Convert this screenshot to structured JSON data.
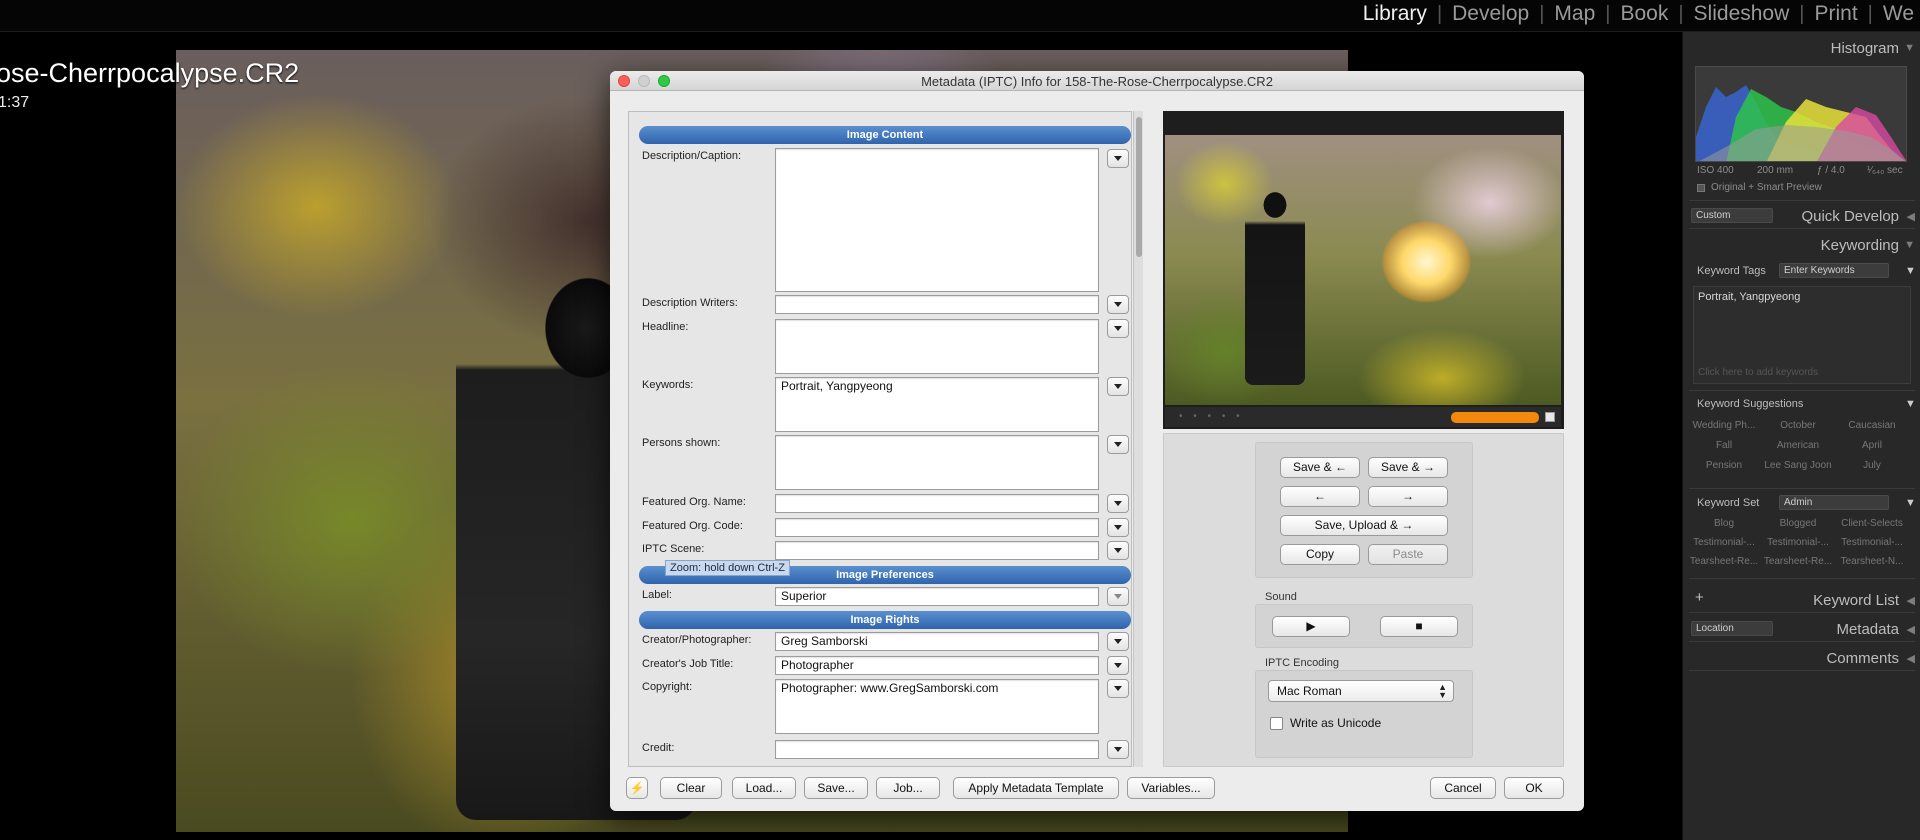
{
  "modules": {
    "items": [
      "Library",
      "Develop",
      "Map",
      "Book",
      "Slideshow",
      "Print",
      "We"
    ],
    "active": "Library"
  },
  "photo": {
    "filename_partial": "ose-Cherrpocalypse.CR2",
    "time_partial": "1:37"
  },
  "dialog": {
    "title": "Metadata (IPTC) Info for 158-The-Rose-Cherrpocalypse.CR2",
    "sections": {
      "content": "Image Content",
      "preferences": "Image Preferences",
      "rights": "Image Rights"
    },
    "fields": {
      "description_label": "Description/Caption:",
      "description_value": "",
      "writers_label": "Description Writers:",
      "writers_value": "",
      "headline_label": "Headline:",
      "headline_value": "",
      "keywords_label": "Keywords:",
      "keywords_value": "Portrait, Yangpyeong",
      "persons_label": "Persons shown:",
      "persons_value": "",
      "org_name_label": "Featured Org. Name:",
      "org_name_value": "",
      "org_code_label": "Featured Org. Code:",
      "org_code_value": "",
      "scene_label": "IPTC Scene:",
      "scene_value": "",
      "label_label": "Label:",
      "label_value": "Superior",
      "creator_label": "Creator/Photographer:",
      "creator_value": "Greg Samborski",
      "job_title_label": "Creator's Job Title:",
      "job_title_value": "Photographer",
      "copyright_label": "Copyright:",
      "copyright_value": "Photographer: www.GregSamborski.com",
      "credit_label": "Credit:",
      "credit_value": ""
    },
    "tooltip": "Zoom: hold down Ctrl-Z",
    "nav_buttons": {
      "save_prev": "Save & ←",
      "save_next": "Save & →",
      "prev": "←",
      "next": "→",
      "save_upload_next": "Save, Upload & →",
      "copy": "Copy",
      "paste": "Paste"
    },
    "sound": {
      "label": "Sound",
      "play": "▶",
      "stop": "■"
    },
    "encoding": {
      "label": "IPTC Encoding",
      "value": "Mac Roman",
      "unicode_label": "Write as Unicode",
      "unicode_checked": false
    },
    "preview": {
      "dots": "• • • • •",
      "progress": 1.0
    },
    "bottom_buttons": {
      "bolt": "⚡",
      "clear": "Clear",
      "load": "Load...",
      "save": "Save...",
      "job": "Job...",
      "apply_template": "Apply Metadata Template",
      "variables": "Variables...",
      "cancel": "Cancel",
      "ok": "OK"
    }
  },
  "sidebar": {
    "histogram": {
      "title": "Histogram",
      "iso": "ISO 400",
      "focal": "200 mm",
      "aperture": "ƒ / 4.0",
      "shutter": "¹⁄₆₄₀ sec",
      "preview_mode": "Original + Smart Preview"
    },
    "quick_develop": {
      "preset": "Custom",
      "title": "Quick Develop"
    },
    "keywording": {
      "title": "Keywording",
      "tags_label": "Keyword Tags",
      "tags_mode": "Enter Keywords",
      "tags_value": "Portrait, Yangpyeong",
      "add_hint": "Click here to add keywords",
      "suggestions_label": "Keyword Suggestions",
      "suggestions": [
        "Wedding Ph...",
        "October",
        "Caucasian",
        "Fall",
        "American",
        "April",
        "Pension",
        "Lee Sang Joon",
        "July"
      ],
      "set_label": "Keyword Set",
      "set_value": "Admin",
      "set_items": [
        "Blog",
        "Blogged",
        "Client-Selects",
        "Testimonial-...",
        "Testimonial-...",
        "Testimonial-...",
        "Tearsheet-Re...",
        "Tearsheet-Re...",
        "Tearsheet-N..."
      ]
    },
    "keyword_list": {
      "title": "Keyword List",
      "plus": "+"
    },
    "metadata": {
      "preset": "Location",
      "title": "Metadata"
    },
    "comments": {
      "title": "Comments"
    }
  }
}
